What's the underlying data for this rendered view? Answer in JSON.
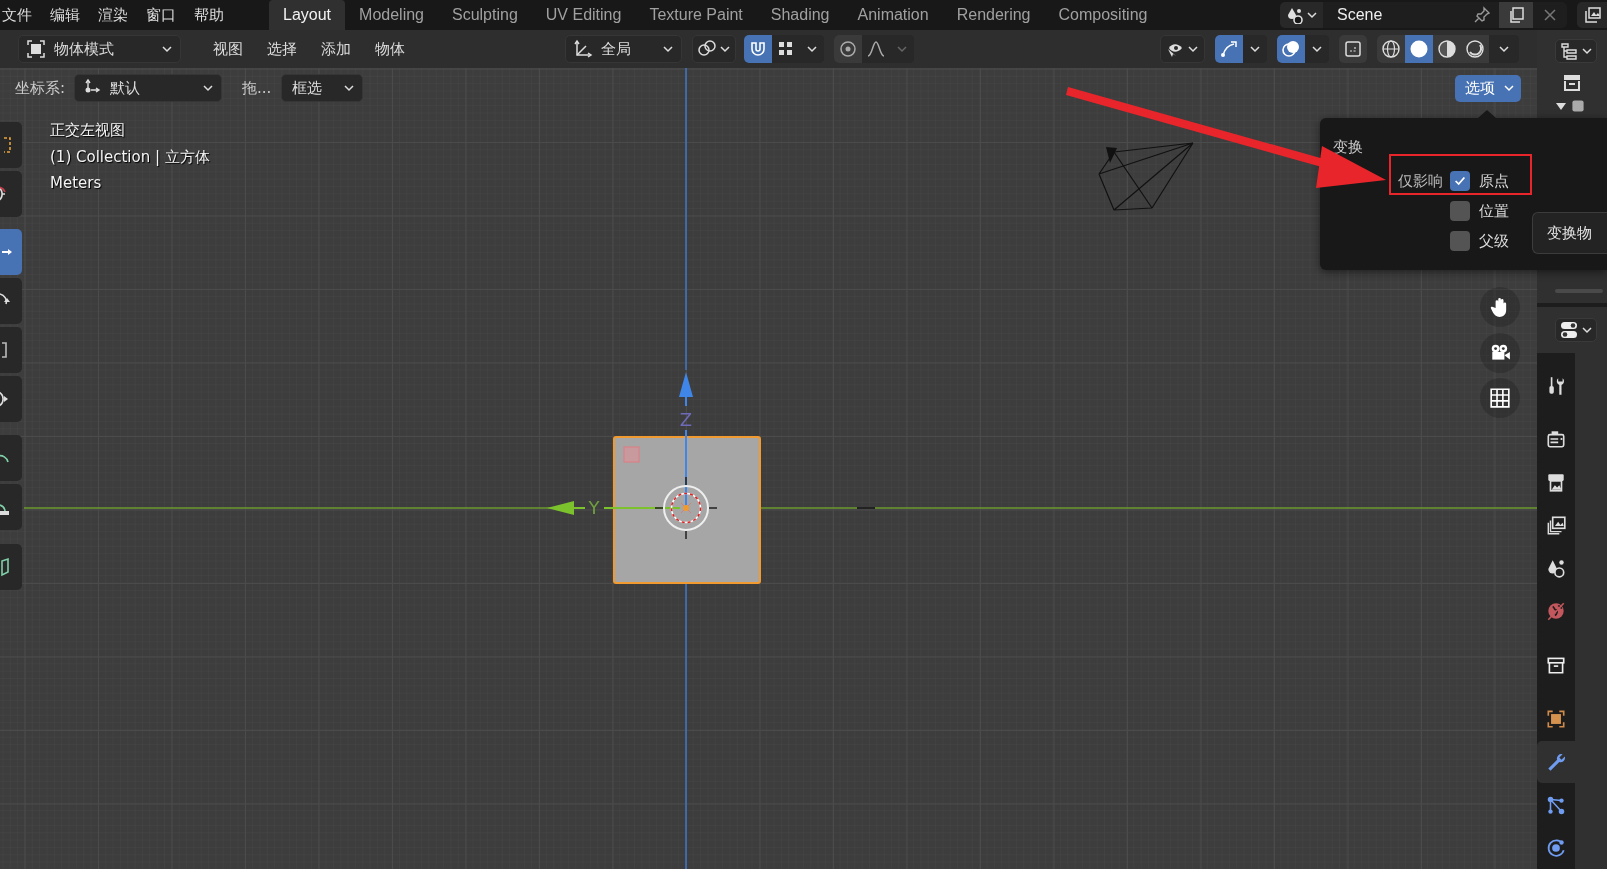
{
  "menu_bar": {
    "menus": [
      "文件",
      "编辑",
      "渲染",
      "窗口",
      "帮助"
    ],
    "workspaces": [
      {
        "label": "Layout",
        "selected": true
      },
      {
        "label": "Modeling",
        "selected": false
      },
      {
        "label": "Sculpting",
        "selected": false
      },
      {
        "label": "UV Editing",
        "selected": false
      },
      {
        "label": "Texture Paint",
        "selected": false
      },
      {
        "label": "Shading",
        "selected": false
      },
      {
        "label": "Animation",
        "selected": false
      },
      {
        "label": "Rendering",
        "selected": false
      },
      {
        "label": "Compositing",
        "selected": false
      }
    ],
    "scene": "Scene"
  },
  "header": {
    "mode": "物体模式",
    "menus": [
      "视图",
      "选择",
      "添加",
      "物体"
    ],
    "orientation": "全局",
    "toggles": {
      "snap": true,
      "proportional_editing": false,
      "gizmos": true,
      "overlays": true,
      "xray": false
    },
    "shading_modes": [
      {
        "kind": "wireframe",
        "selected": false
      },
      {
        "kind": "solid",
        "selected": true
      },
      {
        "kind": "material",
        "selected": false
      },
      {
        "kind": "rendered",
        "selected": false
      }
    ]
  },
  "tool_settings": {
    "orientation_label": "坐标系:",
    "orientation": "默认",
    "drag_label": "拖...",
    "drag": "框选",
    "options": "选项"
  },
  "toolbar": [
    {
      "kind": "select",
      "selected": false
    },
    {
      "kind": "cursor",
      "selected": false
    },
    {
      "kind": "move",
      "selected": true
    },
    {
      "kind": "rotate",
      "selected": false
    },
    {
      "kind": "scale",
      "selected": false
    },
    {
      "kind": "transform",
      "selected": false
    },
    {
      "kind": "annotate",
      "selected": false
    },
    {
      "kind": "measure",
      "selected": false
    },
    {
      "kind": "add_cube",
      "selected": false
    }
  ],
  "viewport": {
    "info": [
      "正交左视图",
      "(1) Collection | 立方体",
      "Meters"
    ],
    "axis_labels": [
      "Z",
      "Y"
    ]
  },
  "options_popup": {
    "section": "变换",
    "affect_label": "仅影响",
    "options": [
      {
        "label": "原点",
        "checked": true
      },
      {
        "label": "位置",
        "checked": false
      },
      {
        "label": "父级",
        "checked": false
      }
    ],
    "tooltip": "变换物"
  },
  "properties": {
    "tabs": [
      {
        "kind": "tool",
        "selected": false
      },
      {
        "kind": "render",
        "selected": false
      },
      {
        "kind": "output",
        "selected": false
      },
      {
        "kind": "view_layer",
        "selected": false
      },
      {
        "kind": "scene",
        "selected": false
      },
      {
        "kind": "world",
        "selected": false
      },
      {
        "kind": "collection",
        "selected": false
      },
      {
        "kind": "object",
        "selected": false
      },
      {
        "kind": "modifiers",
        "selected": true
      },
      {
        "kind": "particles",
        "selected": false
      },
      {
        "kind": "physics",
        "selected": false
      }
    ]
  }
}
